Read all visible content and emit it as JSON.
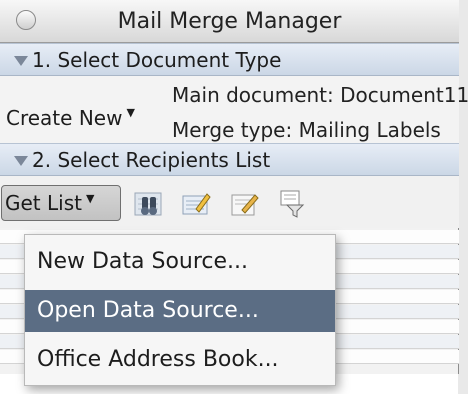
{
  "window": {
    "title": "Mail Merge Manager"
  },
  "section1": {
    "header": "1. Select Document Type",
    "create_new_label": "Create New",
    "main_document": "Main document: Document11",
    "merge_type": "Merge type: Mailing Labels"
  },
  "section2": {
    "header": "2. Select Recipients List",
    "get_list_label": "Get List",
    "toolbar_icons": [
      "find-records-icon",
      "edit-list-icon",
      "edit-document-icon",
      "filter-recipients-icon"
    ]
  },
  "menu": {
    "items": [
      {
        "label": "New Data Source..."
      },
      {
        "label": "Open Data Source..."
      },
      {
        "label": "Office Address Book..."
      }
    ],
    "selected_index": 1
  },
  "colors": {
    "selection": "#5b6d84",
    "section_header": "#d8e1ee"
  }
}
